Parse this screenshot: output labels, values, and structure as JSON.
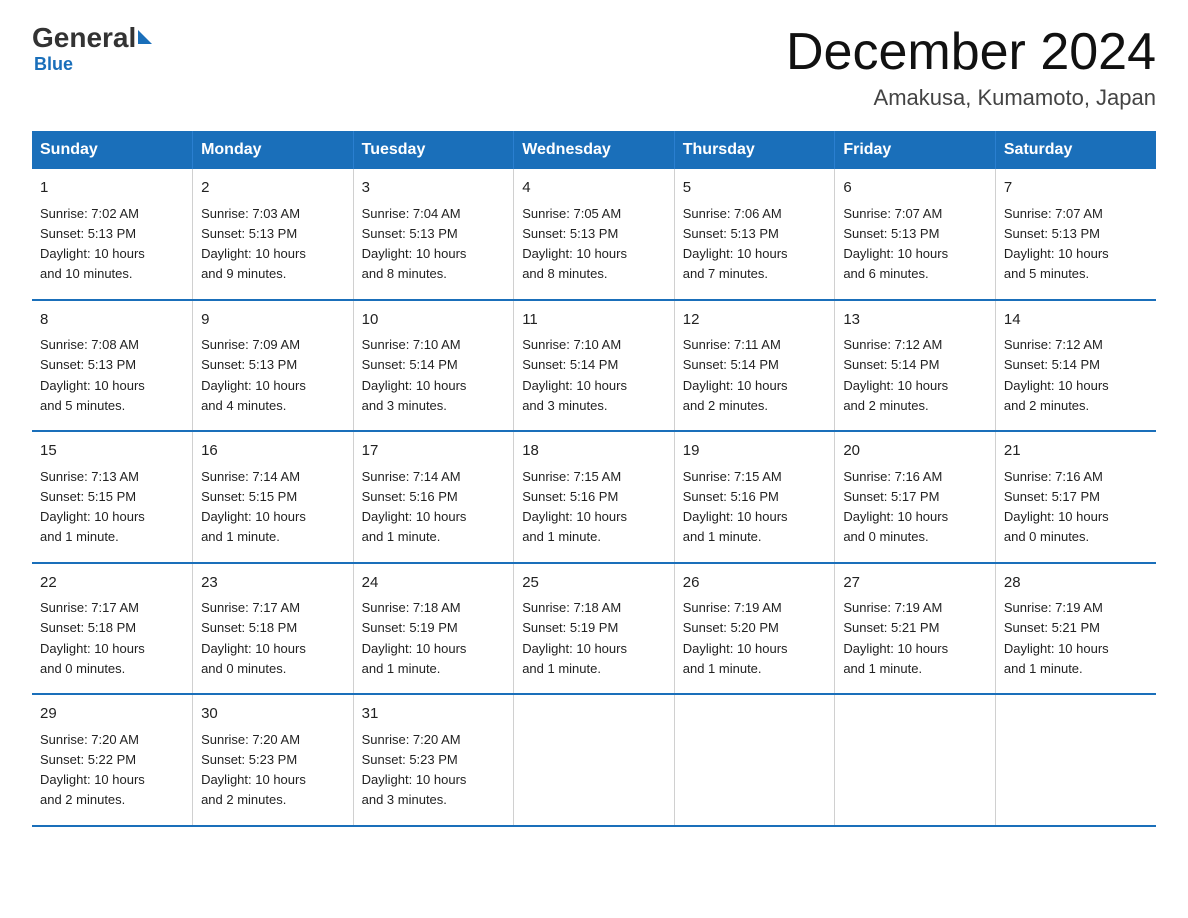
{
  "logo": {
    "general": "General",
    "blue": "Blue",
    "subtitle": "Blue"
  },
  "header": {
    "title": "December 2024",
    "location": "Amakusa, Kumamoto, Japan"
  },
  "days_of_week": [
    "Sunday",
    "Monday",
    "Tuesday",
    "Wednesday",
    "Thursday",
    "Friday",
    "Saturday"
  ],
  "weeks": [
    [
      {
        "day": "1",
        "sunrise": "7:02 AM",
        "sunset": "5:13 PM",
        "daylight": "10 hours and 10 minutes."
      },
      {
        "day": "2",
        "sunrise": "7:03 AM",
        "sunset": "5:13 PM",
        "daylight": "10 hours and 9 minutes."
      },
      {
        "day": "3",
        "sunrise": "7:04 AM",
        "sunset": "5:13 PM",
        "daylight": "10 hours and 8 minutes."
      },
      {
        "day": "4",
        "sunrise": "7:05 AM",
        "sunset": "5:13 PM",
        "daylight": "10 hours and 8 minutes."
      },
      {
        "day": "5",
        "sunrise": "7:06 AM",
        "sunset": "5:13 PM",
        "daylight": "10 hours and 7 minutes."
      },
      {
        "day": "6",
        "sunrise": "7:07 AM",
        "sunset": "5:13 PM",
        "daylight": "10 hours and 6 minutes."
      },
      {
        "day": "7",
        "sunrise": "7:07 AM",
        "sunset": "5:13 PM",
        "daylight": "10 hours and 5 minutes."
      }
    ],
    [
      {
        "day": "8",
        "sunrise": "7:08 AM",
        "sunset": "5:13 PM",
        "daylight": "10 hours and 5 minutes."
      },
      {
        "day": "9",
        "sunrise": "7:09 AM",
        "sunset": "5:13 PM",
        "daylight": "10 hours and 4 minutes."
      },
      {
        "day": "10",
        "sunrise": "7:10 AM",
        "sunset": "5:14 PM",
        "daylight": "10 hours and 3 minutes."
      },
      {
        "day": "11",
        "sunrise": "7:10 AM",
        "sunset": "5:14 PM",
        "daylight": "10 hours and 3 minutes."
      },
      {
        "day": "12",
        "sunrise": "7:11 AM",
        "sunset": "5:14 PM",
        "daylight": "10 hours and 2 minutes."
      },
      {
        "day": "13",
        "sunrise": "7:12 AM",
        "sunset": "5:14 PM",
        "daylight": "10 hours and 2 minutes."
      },
      {
        "day": "14",
        "sunrise": "7:12 AM",
        "sunset": "5:14 PM",
        "daylight": "10 hours and 2 minutes."
      }
    ],
    [
      {
        "day": "15",
        "sunrise": "7:13 AM",
        "sunset": "5:15 PM",
        "daylight": "10 hours and 1 minute."
      },
      {
        "day": "16",
        "sunrise": "7:14 AM",
        "sunset": "5:15 PM",
        "daylight": "10 hours and 1 minute."
      },
      {
        "day": "17",
        "sunrise": "7:14 AM",
        "sunset": "5:16 PM",
        "daylight": "10 hours and 1 minute."
      },
      {
        "day": "18",
        "sunrise": "7:15 AM",
        "sunset": "5:16 PM",
        "daylight": "10 hours and 1 minute."
      },
      {
        "day": "19",
        "sunrise": "7:15 AM",
        "sunset": "5:16 PM",
        "daylight": "10 hours and 1 minute."
      },
      {
        "day": "20",
        "sunrise": "7:16 AM",
        "sunset": "5:17 PM",
        "daylight": "10 hours and 0 minutes."
      },
      {
        "day": "21",
        "sunrise": "7:16 AM",
        "sunset": "5:17 PM",
        "daylight": "10 hours and 0 minutes."
      }
    ],
    [
      {
        "day": "22",
        "sunrise": "7:17 AM",
        "sunset": "5:18 PM",
        "daylight": "10 hours and 0 minutes."
      },
      {
        "day": "23",
        "sunrise": "7:17 AM",
        "sunset": "5:18 PM",
        "daylight": "10 hours and 0 minutes."
      },
      {
        "day": "24",
        "sunrise": "7:18 AM",
        "sunset": "5:19 PM",
        "daylight": "10 hours and 1 minute."
      },
      {
        "day": "25",
        "sunrise": "7:18 AM",
        "sunset": "5:19 PM",
        "daylight": "10 hours and 1 minute."
      },
      {
        "day": "26",
        "sunrise": "7:19 AM",
        "sunset": "5:20 PM",
        "daylight": "10 hours and 1 minute."
      },
      {
        "day": "27",
        "sunrise": "7:19 AM",
        "sunset": "5:21 PM",
        "daylight": "10 hours and 1 minute."
      },
      {
        "day": "28",
        "sunrise": "7:19 AM",
        "sunset": "5:21 PM",
        "daylight": "10 hours and 1 minute."
      }
    ],
    [
      {
        "day": "29",
        "sunrise": "7:20 AM",
        "sunset": "5:22 PM",
        "daylight": "10 hours and 2 minutes."
      },
      {
        "day": "30",
        "sunrise": "7:20 AM",
        "sunset": "5:23 PM",
        "daylight": "10 hours and 2 minutes."
      },
      {
        "day": "31",
        "sunrise": "7:20 AM",
        "sunset": "5:23 PM",
        "daylight": "10 hours and 3 minutes."
      },
      null,
      null,
      null,
      null
    ]
  ],
  "labels": {
    "sunrise": "Sunrise:",
    "sunset": "Sunset:",
    "daylight": "Daylight:"
  }
}
